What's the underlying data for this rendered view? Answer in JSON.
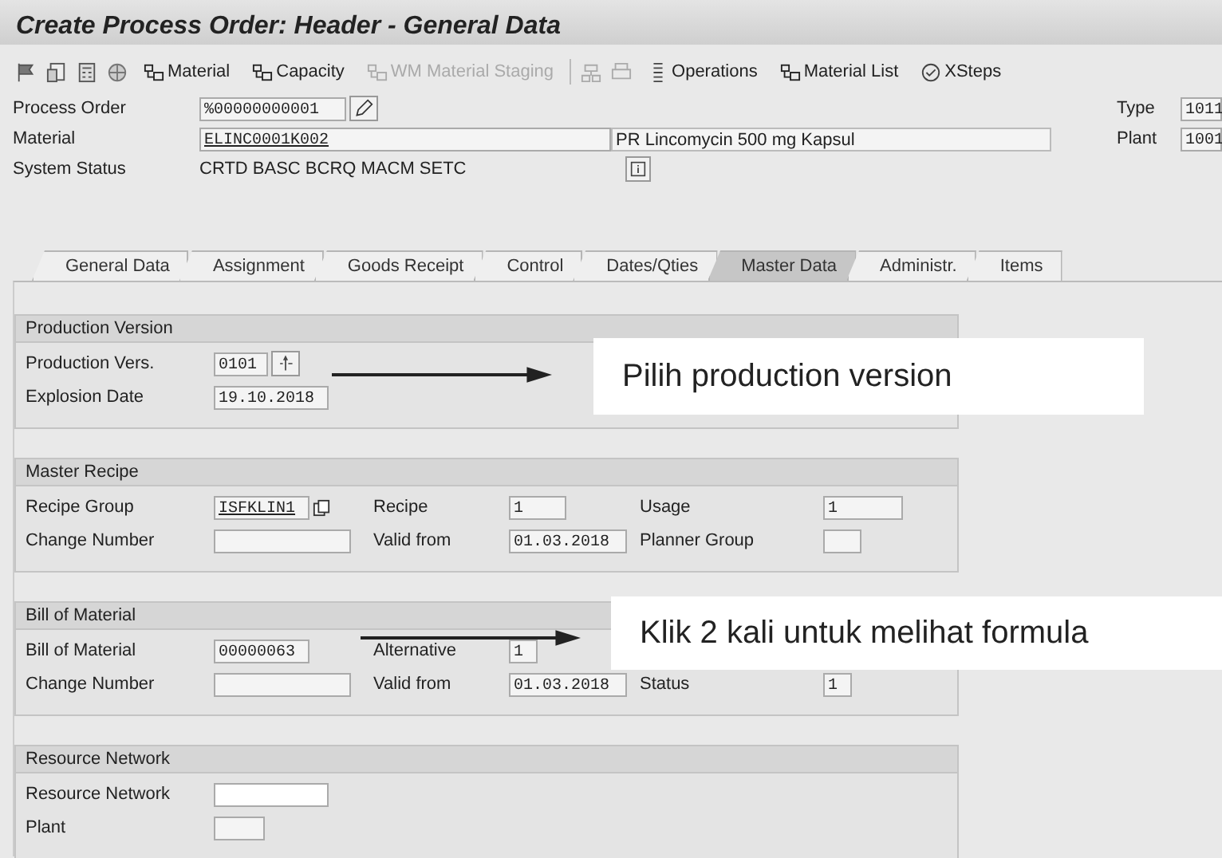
{
  "window": {
    "title": "Create Process Order: Header - General Data"
  },
  "toolbar": [
    {
      "label": "Material",
      "disabled": false
    },
    {
      "label": "Capacity",
      "disabled": false
    },
    {
      "label": "WM Material Staging",
      "disabled": true
    },
    {
      "label": "Operations",
      "disabled": false
    },
    {
      "label": "Material List",
      "disabled": false
    },
    {
      "label": "XSteps",
      "disabled": false
    }
  ],
  "header": {
    "process_order": {
      "label": "Process Order",
      "value": "%00000000001"
    },
    "material": {
      "label": "Material",
      "value": "ELINC0001K002",
      "description": "PR Lincomycin 500 mg Kapsul"
    },
    "system_status": {
      "label": "System Status",
      "value": "CRTD BASC BCRQ MACM SETC"
    },
    "type": {
      "label": "Type",
      "value": "1011"
    },
    "plant": {
      "label": "Plant",
      "value": "1001"
    }
  },
  "tabs": [
    {
      "label": "General Data",
      "selected": false
    },
    {
      "label": "Assignment",
      "selected": false
    },
    {
      "label": "Goods Receipt",
      "selected": false
    },
    {
      "label": "Control",
      "selected": false
    },
    {
      "label": "Dates/Qties",
      "selected": false
    },
    {
      "label": "Master Data",
      "selected": true
    },
    {
      "label": "Administr.",
      "selected": false
    },
    {
      "label": "Items",
      "selected": false
    }
  ],
  "groups": [
    {
      "title": "Production Version",
      "rows": [
        [
          {
            "label": "Production Vers.",
            "value": "0101",
            "kind": "help"
          }
        ],
        [
          {
            "label": "Explosion Date",
            "value": "19.10.2018",
            "kind": "plain"
          }
        ]
      ]
    },
    {
      "title": "Master Recipe",
      "rows": [
        [
          {
            "label": "Recipe Group",
            "value": "ISFKLIN1",
            "kind": "copy"
          },
          {
            "label": "Recipe",
            "value": "1",
            "kind": "plain"
          },
          {
            "label": "Usage",
            "value": "1",
            "kind": "plain"
          }
        ],
        [
          {
            "label": "Change Number",
            "kind": "plain"
          },
          {
            "label": "Valid from",
            "value": "01.03.2018",
            "kind": "plain"
          },
          {
            "label": "Planner Group",
            "kind": "plain"
          }
        ]
      ]
    },
    {
      "title": "Bill of Material",
      "rows": [
        [
          {
            "label": "Bill of Material",
            "value": "00000063",
            "kind": "plain"
          },
          {
            "label": "Alternative",
            "value": "1",
            "kind": "plain"
          }
        ],
        [
          {
            "label": "Change Number",
            "kind": "plain"
          },
          {
            "label": "Valid from",
            "value": "01.03.2018",
            "kind": "plain"
          },
          {
            "label": "Status",
            "value": "1",
            "kind": "plain"
          }
        ]
      ]
    },
    {
      "title": "Resource Network",
      "rows": [
        [
          {
            "label": "Resource Network",
            "kind": "plain"
          }
        ],
        [
          {
            "label": "Plant",
            "kind": "plain"
          }
        ]
      ]
    }
  ],
  "annotations": [
    {
      "text": "Pilih production version"
    },
    {
      "text": "Klik 2 kali untuk melihat formula"
    }
  ]
}
